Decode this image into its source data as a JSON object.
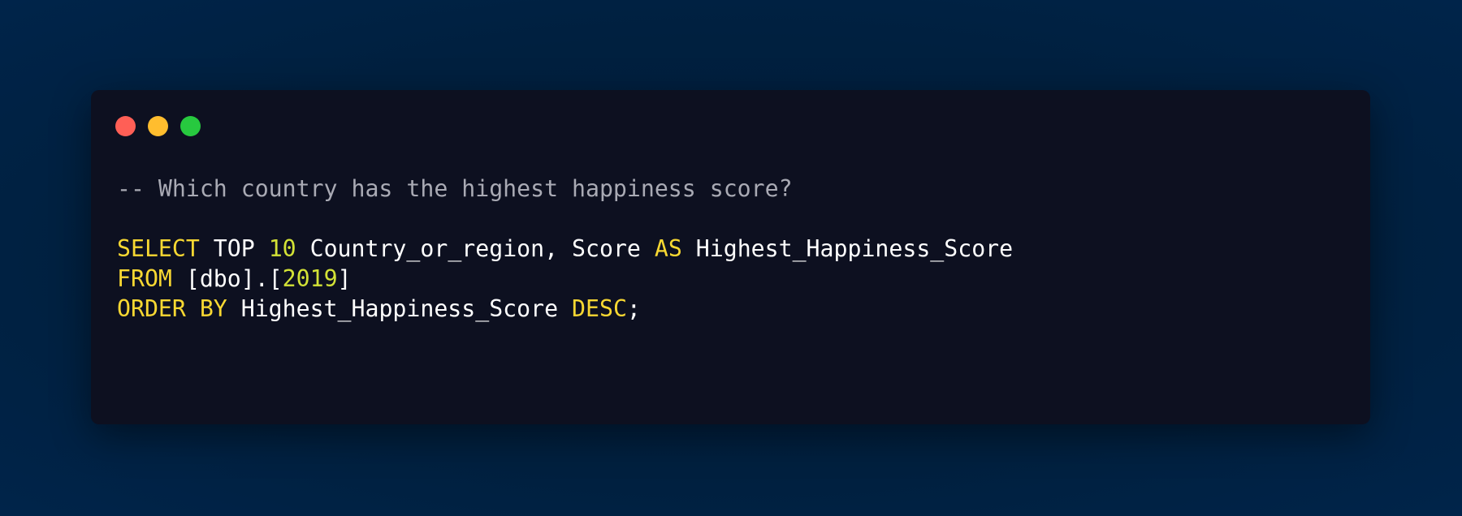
{
  "window": {
    "controls": [
      {
        "name": "close",
        "color": "#ff5f56"
      },
      {
        "name": "minimize",
        "color": "#ffbd2e"
      },
      {
        "name": "maximize",
        "color": "#27c93f"
      }
    ]
  },
  "code": {
    "comment": "-- Which country has the highest happiness score?",
    "line1": {
      "kw_select": "SELECT",
      "top": " TOP ",
      "num_10": "10",
      "columns": " Country_or_region, Score ",
      "kw_as": "AS",
      "alias": " Highest_Happiness_Score"
    },
    "line2": {
      "kw_from": "FROM",
      "table_open": " [dbo].[",
      "num_2019": "2019",
      "table_close": "]"
    },
    "line3": {
      "kw_order_by": "ORDER BY",
      "order_col": " Highest_Happiness_Score ",
      "kw_desc": "DESC",
      "terminator": ";"
    }
  }
}
